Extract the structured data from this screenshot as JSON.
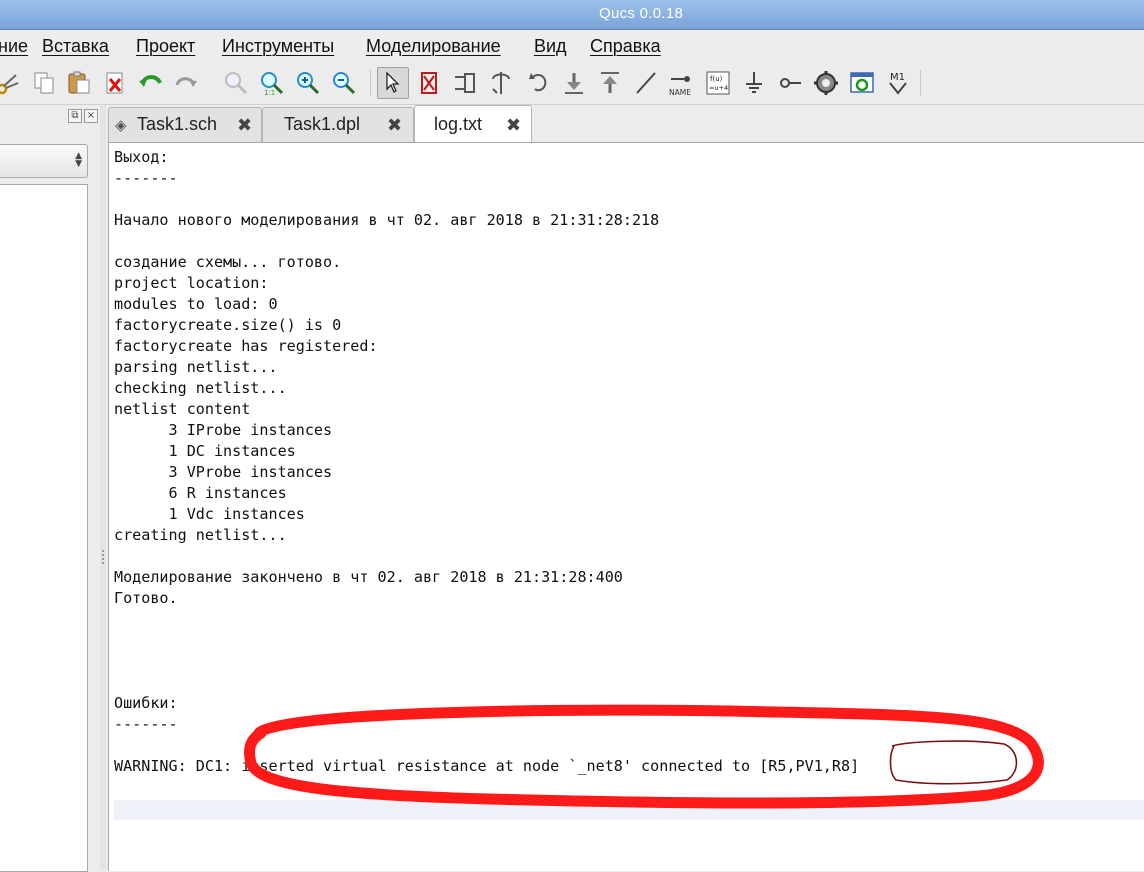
{
  "window": {
    "title": "Qucs 0.0.18"
  },
  "menu": [
    "ние",
    "Вставка",
    "Проект",
    "Инструменты",
    "Моделирование",
    "Вид",
    "Справка"
  ],
  "toolbar": {
    "icons": [
      "cut-icon",
      "copy-icon",
      "paste-icon",
      "delete-icon",
      "undo-icon",
      "redo-icon",
      "zoom-view-all-icon",
      "zoom-one-to-one-icon",
      "zoom-in-icon",
      "zoom-out-icon",
      "select-pointer-icon",
      "deactivate-icon",
      "mirror-x-icon",
      "mirror-y-icon",
      "rotate-icon",
      "go-into-subcircuit-icon",
      "pop-out-icon",
      "wire-icon",
      "label-name-icon",
      "equation-icon",
      "ground-icon",
      "port-icon",
      "simulate-icon",
      "view-data-display-icon",
      "marker-icon"
    ],
    "name_label": "NAME",
    "equation_label": "f(u)=u+4",
    "marker_label": "M1"
  },
  "tabs": [
    {
      "label": "Task1.sch",
      "icon": "schematic-icon",
      "active": false
    },
    {
      "label": "Task1.dpl",
      "icon": "",
      "active": false
    },
    {
      "label": "log.txt",
      "icon": "",
      "active": true
    }
  ],
  "log": {
    "lines": [
      "Выход:",
      "-------",
      "",
      "Начало нового моделирования в чт 02. авг 2018 в 21:31:28:218",
      "",
      "создание схемы... готово.",
      "project location:",
      "modules to load: 0",
      "factorycreate.size() is 0",
      "factorycreate has registered:",
      "parsing netlist...",
      "checking netlist...",
      "netlist content",
      "      3 IProbe instances",
      "      1 DC instances",
      "      3 VProbe instances",
      "      6 R instances",
      "      1 Vdc instances",
      "creating netlist...",
      "",
      "Моделирование закончено в чт 02. авг 2018 в 21:31:28:400",
      "Готово.",
      "",
      "",
      "",
      "",
      "Ошибки:",
      "-------",
      "",
      "WARNING: DC1: inserted virtual resistance at node `_net8' connected to [R5,PV1,R8]"
    ]
  },
  "colors": {
    "annotation_red": "#ff1a1a",
    "annotation_darkred": "#7a1010",
    "title_bar": "#8fb4e3"
  }
}
